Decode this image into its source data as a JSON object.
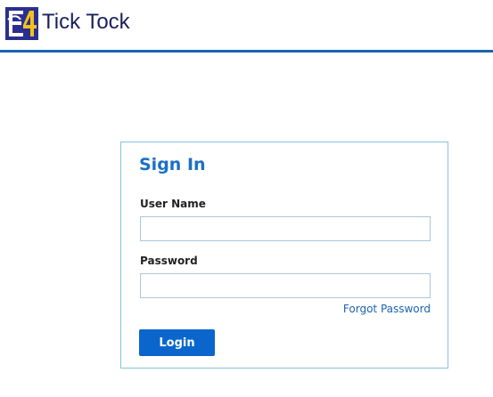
{
  "header": {
    "brand_name": "Tick Tock",
    "logo_icon": "e4-logo-icon",
    "colors": {
      "logo_blue": "#2a2f8f",
      "logo_yellow": "#f3c21a",
      "header_rule": "#1a63b2"
    }
  },
  "signin": {
    "title": "Sign In",
    "username_label": "User Name",
    "username_value": "",
    "username_placeholder": "",
    "password_label": "Password",
    "password_value": "",
    "password_placeholder": "",
    "forgot_link": "Forgot Password",
    "login_button": "Login",
    "colors": {
      "title": "#1a6fc4",
      "button": "#0a66cc",
      "card_border": "#86c3e0"
    }
  }
}
